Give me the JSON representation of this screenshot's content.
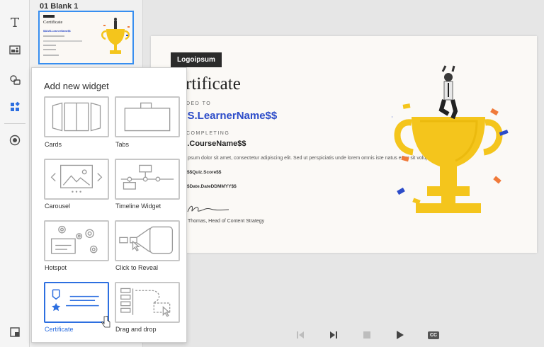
{
  "slides": {
    "first_label": "01  Blank 1"
  },
  "popup": {
    "title": "Add new widget",
    "widgets": [
      {
        "label": "Cards"
      },
      {
        "label": "Tabs"
      },
      {
        "label": "Carousel"
      },
      {
        "label": "Timeline Widget"
      },
      {
        "label": "Hotspot"
      },
      {
        "label": "Click to Reveal"
      },
      {
        "label": "Certificate"
      },
      {
        "label": "Drag and drop"
      }
    ]
  },
  "certificate": {
    "logo": "Logoipsum",
    "title": "ertificate",
    "awarded_to": "DED TO",
    "learner": "MS.LearnerName$$",
    "completing": "COMPLETING",
    "course": "S.CourseName$$",
    "body": "psum dolor sit amet, consectetur adipiscing elit. Sed ut perspiciatis unde lorem omnis iste natus error sit voluptatem accus.",
    "score": "$$Quiz.Score$$",
    "date": "$Date.DateDDMMYY$$",
    "signer": "Thomas, Head of Content Strategy"
  },
  "thumb": {
    "title": "Certificate",
    "learner": "$$LMS.LearnerName$$"
  },
  "colors": {
    "accent": "#2d6fe0",
    "learner_text": "#2c4cc9",
    "trophy": "#f4c51c"
  }
}
